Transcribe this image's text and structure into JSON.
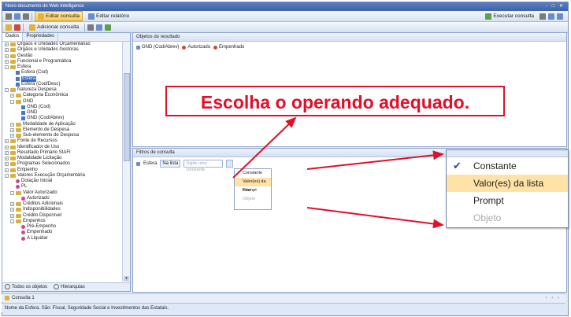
{
  "window": {
    "title": "Novo documento do Web Intelligence",
    "controls": "- □ ✕"
  },
  "toolbar1": {
    "edit_query": "Editar consulta",
    "edit_report": "Editar relatório",
    "run_query": "Executar consulta"
  },
  "toolbar2": {
    "add_query": "Adicionar consulta"
  },
  "left_panel": {
    "tabs": [
      "Dados",
      "Propriedades"
    ],
    "tree": [
      {
        "label": "Órgãos e Unidades Orçamentárias",
        "level": 1,
        "kind": "folder",
        "expander": "+"
      },
      {
        "label": "Órgãos e Unidades Gestoras",
        "level": 1,
        "kind": "folder",
        "expander": "+"
      },
      {
        "label": "Gestão",
        "level": 1,
        "kind": "folder",
        "expander": "+"
      },
      {
        "label": "Funcional e Programática",
        "level": 1,
        "kind": "folder",
        "expander": "+"
      },
      {
        "label": "Esfera",
        "level": 1,
        "kind": "folder",
        "expander": "-"
      },
      {
        "label": "Esfera (Cod)",
        "level": 2,
        "kind": "dim"
      },
      {
        "label": "Esfera",
        "level": 2,
        "kind": "dim",
        "selected": true
      },
      {
        "label": "Esfera (Cod/Desc)",
        "level": 2,
        "kind": "dim"
      },
      {
        "label": "Natureza Despesa",
        "level": 1,
        "kind": "folder",
        "expander": "-"
      },
      {
        "label": "Categoria Econômica",
        "level": 2,
        "kind": "folder",
        "expander": "+"
      },
      {
        "label": "GND",
        "level": 2,
        "kind": "folder",
        "expander": "-"
      },
      {
        "label": "GND (Cod)",
        "level": 3,
        "kind": "dim"
      },
      {
        "label": "GND",
        "level": 3,
        "kind": "dim"
      },
      {
        "label": "GND (Cod/Abrev)",
        "level": 3,
        "kind": "dim"
      },
      {
        "label": "Modalidade de Aplicação",
        "level": 2,
        "kind": "folder",
        "expander": "+"
      },
      {
        "label": "Elemento de Despesa",
        "level": 2,
        "kind": "folder",
        "expander": "+"
      },
      {
        "label": "Sub-elemento de Despesa",
        "level": 2,
        "kind": "folder",
        "expander": "+"
      },
      {
        "label": "Fonte de Recursos",
        "level": 1,
        "kind": "folder",
        "expander": "+"
      },
      {
        "label": "Identificador de Uso",
        "level": 1,
        "kind": "folder",
        "expander": "+"
      },
      {
        "label": "Resultado Primário SIAFI",
        "level": 1,
        "kind": "folder",
        "expander": "+"
      },
      {
        "label": "Modalidade Licitação",
        "level": 1,
        "kind": "folder",
        "expander": "+"
      },
      {
        "label": "Programas Selecionados",
        "level": 1,
        "kind": "folder",
        "expander": "+"
      },
      {
        "label": "Empenho",
        "level": 1,
        "kind": "folder",
        "expander": "+"
      },
      {
        "label": "Valores Execução Orçamentária",
        "level": 1,
        "kind": "folder",
        "expander": "-"
      },
      {
        "label": "Dotação Inicial",
        "level": 2,
        "kind": "measure"
      },
      {
        "label": "PL",
        "level": 2,
        "kind": "measure"
      },
      {
        "label": "Valor Autorizado",
        "level": 2,
        "kind": "folder",
        "expander": "-"
      },
      {
        "label": "Autorizado",
        "level": 3,
        "kind": "measure"
      },
      {
        "label": "Créditos Adicionais",
        "level": 2,
        "kind": "folder",
        "expander": "+"
      },
      {
        "label": "Indisponibilidades",
        "level": 2,
        "kind": "folder",
        "expander": "+"
      },
      {
        "label": "Crédito Disponível",
        "level": 2,
        "kind": "folder",
        "expander": "+"
      },
      {
        "label": "Empenhos",
        "level": 2,
        "kind": "folder",
        "expander": "-"
      },
      {
        "label": "Pré-Empenho",
        "level": 3,
        "kind": "measure"
      },
      {
        "label": "Empenhado",
        "level": 3,
        "kind": "measure"
      },
      {
        "label": "A Liquidar",
        "level": 3,
        "kind": "measure"
      }
    ],
    "radio_all": "Todos os objetos",
    "radio_hier": "Hierarquias"
  },
  "result_objects": {
    "title": "Objetos do resultado",
    "chips": [
      "GND (Cod/Abrev)",
      "Autorizado",
      "Empenhado"
    ]
  },
  "query_filters": {
    "title": "Filtros de consulta",
    "object": "Esfera",
    "operator": "Na lista",
    "value_placeholder": "Digite uma constante",
    "menu": [
      "Constante",
      "Valor(es) da lista",
      "Prompt",
      "Objeto"
    ]
  },
  "callout": "Escolha o operando adequado.",
  "zoom_menu": {
    "checked": "Constante",
    "highlighted": "Valor(es) da lista",
    "items": [
      "Constante",
      "Valor(es) da lista",
      "Prompt",
      "Objeto"
    ]
  },
  "doc_tab": "Consulta 1",
  "status": "Nome da Esfera. São: Fiscal, Seguridade Social e Investimentos das Estatais.",
  "colors": {
    "callout": "#e0102a",
    "highlight": "#ffe3a6",
    "selection": "#316ac5"
  }
}
